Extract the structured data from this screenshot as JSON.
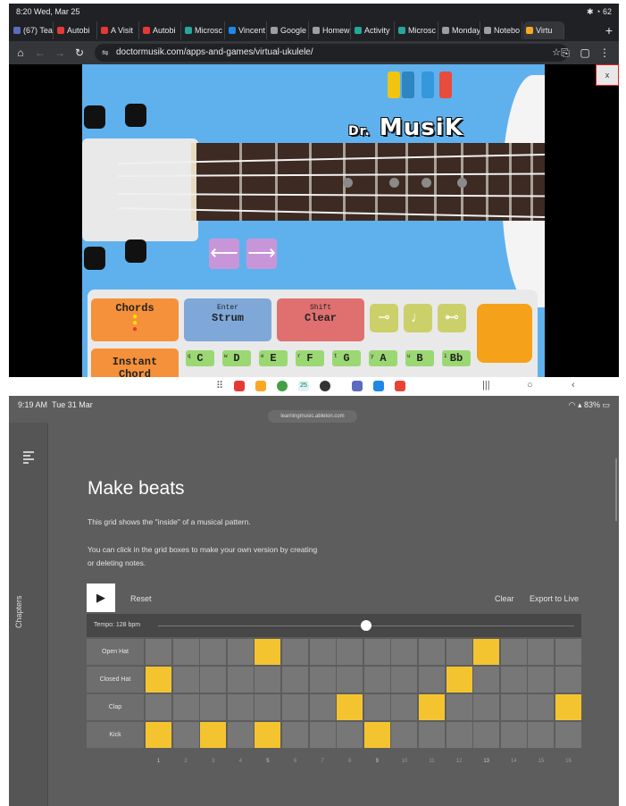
{
  "top": {
    "status": {
      "time": "8:20",
      "date": "Wed, Mar 25",
      "battery": "62"
    },
    "tabs": [
      {
        "label": "(67) Tea",
        "color": "#5c6bc0"
      },
      {
        "label": "Autobi",
        "color": "#e53935"
      },
      {
        "label": "A Visit",
        "color": "#e53935"
      },
      {
        "label": "Autobi",
        "color": "#e53935"
      },
      {
        "label": "Microsc",
        "color": "#26a69a"
      },
      {
        "label": "Vincent",
        "color": "#1e88e5"
      },
      {
        "label": "Google",
        "color": "#9e9e9e"
      },
      {
        "label": "Homew",
        "color": "#9e9e9e"
      },
      {
        "label": "Activity",
        "color": "#26a69a"
      },
      {
        "label": "Microsc",
        "color": "#26a69a"
      },
      {
        "label": "Monday",
        "color": "#9e9e9e"
      },
      {
        "label": "Notebo",
        "color": "#9e9e9e"
      },
      {
        "label": "Virtu",
        "color": "#f9a825"
      }
    ],
    "url": "doctormusik.com/apps-and-games/virtual-ukulele/",
    "close_label": "x",
    "logo": {
      "prefix": "Dr.",
      "name": "MusiK"
    },
    "buttons": {
      "chords": "Chords",
      "strum_sub": "Enter",
      "strum": "Strum",
      "clear_sub": "Shift",
      "clear": "Clear",
      "instant": "Instant",
      "instant2": "Chord"
    },
    "keys": [
      {
        "shortcut": "q",
        "note": "C"
      },
      {
        "shortcut": "w",
        "note": "D"
      },
      {
        "shortcut": "e",
        "note": "E"
      },
      {
        "shortcut": "r",
        "note": "F"
      },
      {
        "shortcut": "t",
        "note": "G"
      },
      {
        "shortcut": "y",
        "note": "A"
      },
      {
        "shortcut": "u",
        "note": "B"
      },
      {
        "shortcut": "i",
        "note": "Bb"
      }
    ],
    "taskbar_badge": "25"
  },
  "bottom": {
    "status": {
      "time": "9:19 AM",
      "date": "Tue 31 Mar",
      "battery": "83%"
    },
    "url": "learningmusic.ableton.com",
    "sidebar_label": "Chapters",
    "title": "Make beats",
    "para1": "This grid shows the \"inside\" of a musical pattern.",
    "para2": "You can click in the grid boxes to make your own version by creating or deleting notes.",
    "reset": "Reset",
    "clear": "Clear",
    "export": "Export to Live",
    "tempo_label": "Tempo: 128 bpm",
    "tempo_fraction": 0.5,
    "rows": [
      "Open Hat",
      "Closed Hat",
      "Clap",
      "Kick"
    ],
    "grid": [
      [
        0,
        0,
        0,
        0,
        1,
        0,
        0,
        0,
        0,
        0,
        0,
        0,
        1,
        0,
        0,
        0
      ],
      [
        1,
        0,
        0,
        0,
        0,
        0,
        0,
        0,
        0,
        0,
        0,
        1,
        0,
        0,
        0,
        0
      ],
      [
        0,
        0,
        0,
        0,
        0,
        0,
        0,
        1,
        0,
        0,
        1,
        0,
        0,
        0,
        0,
        1
      ],
      [
        1,
        0,
        1,
        0,
        1,
        0,
        0,
        0,
        1,
        0,
        0,
        0,
        0,
        0,
        0,
        0
      ]
    ],
    "steps": [
      "1",
      "2",
      "3",
      "4",
      "5",
      "6",
      "7",
      "8",
      "9",
      "10",
      "11",
      "12",
      "13",
      "14",
      "15",
      "16"
    ]
  }
}
